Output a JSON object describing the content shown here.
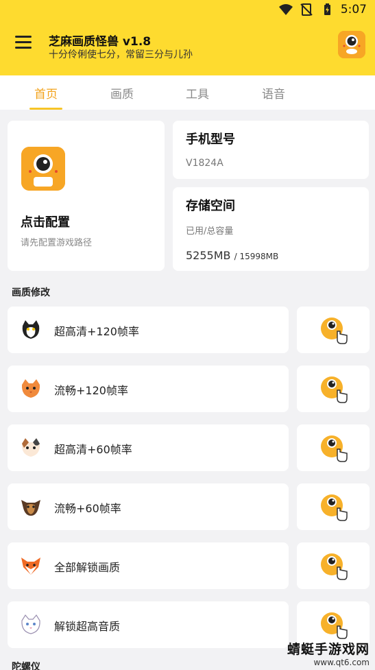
{
  "status_bar": {
    "time": "5:07"
  },
  "app_bar": {
    "title": "芝麻画质怪兽 v1.8",
    "subtitle": "十分伶俐使七分，常留三分与儿孙"
  },
  "tabs": [
    {
      "label": "首页",
      "active": true
    },
    {
      "label": "画质",
      "active": false
    },
    {
      "label": "工具",
      "active": false
    },
    {
      "label": "语音",
      "active": false
    }
  ],
  "config_card": {
    "title": "点击配置",
    "subtitle": "请先配置游戏路径"
  },
  "phone_card": {
    "title": "手机型号",
    "value": "V1824A"
  },
  "storage_card": {
    "title": "存储空间",
    "label": "已用/总容量",
    "used": "5255MB",
    "total": "/ 15998MB"
  },
  "sections": {
    "quality": "画质修改",
    "gyro": "陀螺仪"
  },
  "quality_options": [
    {
      "label": "超高清+120帧率",
      "icon": "black-white-cat-icon"
    },
    {
      "label": "流畅+120帧率",
      "icon": "orange-cat-icon"
    },
    {
      "label": "超高清+60帧率",
      "icon": "calico-cat-icon"
    },
    {
      "label": "流畅+60帧率",
      "icon": "yorkie-dog-icon"
    },
    {
      "label": "全部解锁画质",
      "icon": "fox-icon"
    },
    {
      "label": "解锁超高音质",
      "icon": "white-cat-icon"
    }
  ],
  "watermark": {
    "main": "蜻蜓手游戏网",
    "url": "www.qt6.com"
  },
  "colors": {
    "brand_yellow": "#fedb2f",
    "tab_active": "#f2a21a"
  }
}
